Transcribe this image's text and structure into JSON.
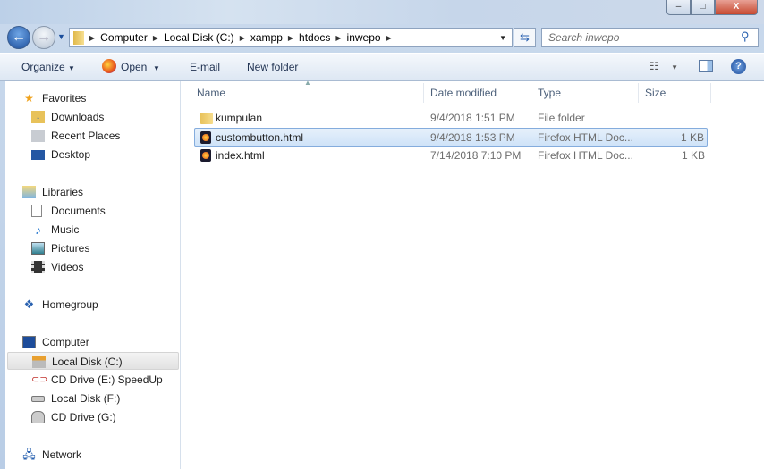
{
  "window": {
    "minimize": "–",
    "maximize": "□",
    "close": "X"
  },
  "address": {
    "crumbs": [
      "Computer",
      "Local Disk (C:)",
      "xampp",
      "htdocs",
      "inwepo"
    ]
  },
  "search": {
    "placeholder": "Search inwepo"
  },
  "toolbar": {
    "organize": "Organize",
    "open": "Open",
    "email": "E-mail",
    "new_folder": "New folder"
  },
  "sidebar": {
    "favorites": "Favorites",
    "downloads": "Downloads",
    "recent": "Recent Places",
    "desktop": "Desktop",
    "libraries": "Libraries",
    "documents": "Documents",
    "music": "Music",
    "pictures": "Pictures",
    "videos": "Videos",
    "homegroup": "Homegroup",
    "computer": "Computer",
    "local_c": "Local Disk (C:)",
    "cd_e": "CD Drive (E:) SpeedUp",
    "local_f": "Local Disk (F:)",
    "cd_g": "CD Drive (G:)",
    "network": "Network"
  },
  "columns": {
    "name": "Name",
    "date": "Date modified",
    "type": "Type",
    "size": "Size"
  },
  "files": [
    {
      "name": "kumpulan",
      "date": "9/4/2018 1:51 PM",
      "type": "File folder",
      "size": "",
      "icon": "folder-icon"
    },
    {
      "name": "custombutton.html",
      "date": "9/4/2018 1:53 PM",
      "type": "Firefox HTML Doc...",
      "size": "1 KB",
      "icon": "firefox-html-icon",
      "selected": true
    },
    {
      "name": "index.html",
      "date": "7/14/2018 7:10 PM",
      "type": "Firefox HTML Doc...",
      "size": "1 KB",
      "icon": "firefox-html-icon"
    }
  ]
}
